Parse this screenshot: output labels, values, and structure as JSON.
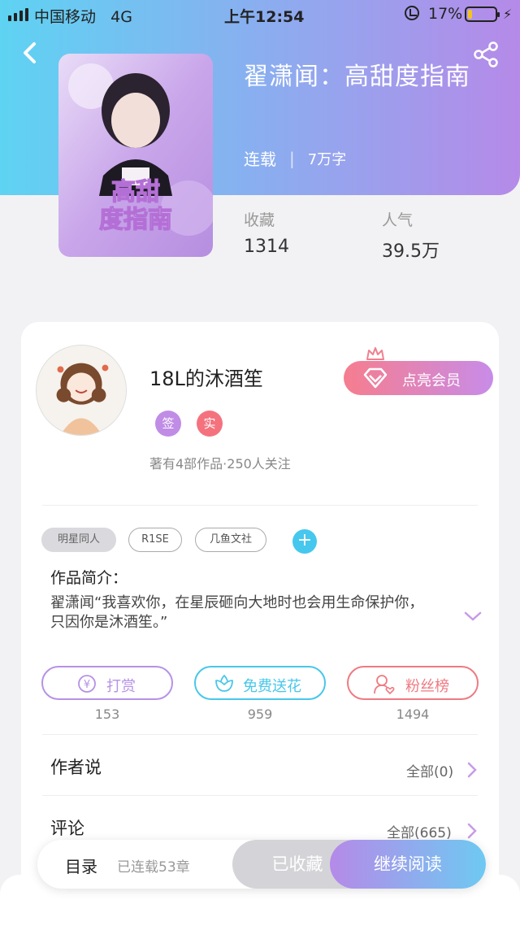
{
  "status_bar": {
    "carrier": "中国移动",
    "network": "4G",
    "time": "上午12:54",
    "battery": "17%",
    "battery_level": 0.17
  },
  "book": {
    "title": "翟潇闻：高甜度指南",
    "state": "连载",
    "word_count": "7万字",
    "cover_text": "高甜度指南",
    "stats": [
      {
        "label": "收藏",
        "value": "1314"
      },
      {
        "label": "人气",
        "value": "39.5万"
      }
    ]
  },
  "author": {
    "name": "18L的沐酒笙",
    "badges": [
      {
        "text": "签",
        "color": "#c08ce6"
      },
      {
        "text": "实",
        "color": "#f4727e"
      }
    ],
    "meta": "著有4部作品·250人关注",
    "vip_button": "点亮会员"
  },
  "tags": [
    "明星同人",
    "R1SE",
    "几鱼文社"
  ],
  "intro": {
    "heading": "作品简介：",
    "text": "翟潇闻“我喜欢你，在星辰砸向大地时也会用生命保护你，只因你是沐酒笙。”"
  },
  "actions": [
    {
      "label": "打赏",
      "count": "153",
      "color": "#b692e6",
      "icon": "yen-coin-icon"
    },
    {
      "label": "免费送花",
      "count": "959",
      "color": "#48c7e9",
      "icon": "flower-icon"
    },
    {
      "label": "粉丝榜",
      "count": "1494",
      "color": "#ef7a82",
      "icon": "fan-user-icon"
    }
  ],
  "sections": [
    {
      "title": "作者说",
      "link": "全部(0)"
    },
    {
      "title": "评论",
      "link": "全部(665)"
    }
  ],
  "bottom_bar": {
    "toc": "目录",
    "chapters": "已连载53章",
    "favorited": "已收藏",
    "continue": "继续阅读"
  }
}
